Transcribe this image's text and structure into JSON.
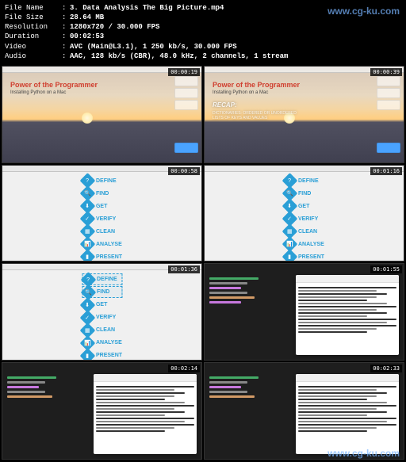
{
  "meta": {
    "labels": {
      "file_name": "File Name",
      "file_size": "File Size",
      "resolution": "Resolution",
      "duration": "Duration",
      "video": "Video",
      "audio": "Audio"
    },
    "values": {
      "file_name": "3. Data Analysis The Big Picture.mp4",
      "file_size": "28.64 MB",
      "resolution": "1280x720 / 30.000 FPS",
      "duration": "00:02:53",
      "video": "AVC (Main@L3.1), 1 250 kb/s, 30.000 FPS",
      "audio": "AAC, 128 kb/s (CBR), 48.0 kHz, 2 channels, 1 stream"
    }
  },
  "watermark": "www.cg-ku.com",
  "thumbnails": {
    "timestamps": [
      "00:00:19",
      "00:00:39",
      "00:00:58",
      "00:01:16",
      "00:01:36",
      "00:01:55",
      "00:02:14",
      "00:02:33"
    ],
    "slide_title": "Power of the Programmer",
    "slide_sub": "Installing Python on a Mac",
    "recap_title": "RECAP:",
    "recap_line1": "DICTIONARIES: ORDERED OR UNORDERED",
    "recap_line2": "LISTS OF KEYS AND VALUES",
    "steps": [
      {
        "icon": "?",
        "label": "DEFINE"
      },
      {
        "icon": "🔍",
        "label": "FIND"
      },
      {
        "icon": "⬇",
        "label": "GET"
      },
      {
        "icon": "✓",
        "label": "VERIFY"
      },
      {
        "icon": "▦",
        "label": "CLEAN"
      },
      {
        "icon": "📊",
        "label": "ANALYSE"
      },
      {
        "icon": "▮",
        "label": "PRESENT"
      }
    ]
  }
}
